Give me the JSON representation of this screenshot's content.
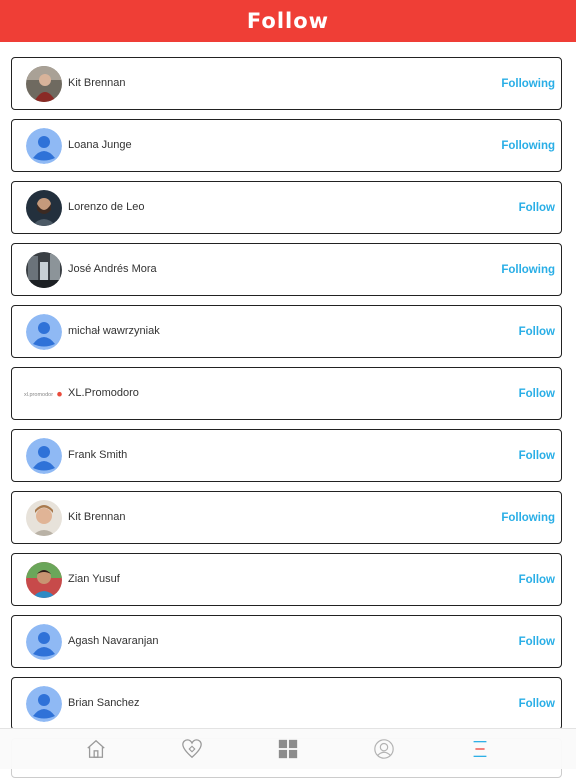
{
  "header": {
    "title": "Follow"
  },
  "colors": {
    "accent": "#ef3e36",
    "link": "#29aee6"
  },
  "users": [
    {
      "name": "Kit Brennan",
      "action": "Following",
      "avatar": "photo-red"
    },
    {
      "name": "Loana Junge",
      "action": "Following",
      "avatar": "default-person-icon"
    },
    {
      "name": "Lorenzo de Leo",
      "action": "Follow",
      "avatar": "photo-dark"
    },
    {
      "name": "José Andrés Mora",
      "action": "Following",
      "avatar": "photo-street"
    },
    {
      "name": "michał wawrzyniak",
      "action": "Follow",
      "avatar": "default-person-icon"
    },
    {
      "name": "XL.Promodoro",
      "action": "Follow",
      "avatar": "logo",
      "logo_text": "xl.promodoro"
    },
    {
      "name": "Frank Smith",
      "action": "Follow",
      "avatar": "default-person-icon"
    },
    {
      "name": "Kit Brennan",
      "action": "Following",
      "avatar": "photo-light"
    },
    {
      "name": "Zian Yusuf",
      "action": "Follow",
      "avatar": "photo-green"
    },
    {
      "name": "Agash Navaranjan",
      "action": "Follow",
      "avatar": "default-person-icon"
    },
    {
      "name": "Brian Sanchez",
      "action": "Follow",
      "avatar": "default-person-icon"
    }
  ],
  "tabbar": {
    "tabs": [
      {
        "icon": "home-icon"
      },
      {
        "icon": "heart-icon"
      },
      {
        "icon": "grid-icon"
      },
      {
        "icon": "profile-icon"
      },
      {
        "icon": "menu-icon",
        "active": true
      }
    ]
  }
}
